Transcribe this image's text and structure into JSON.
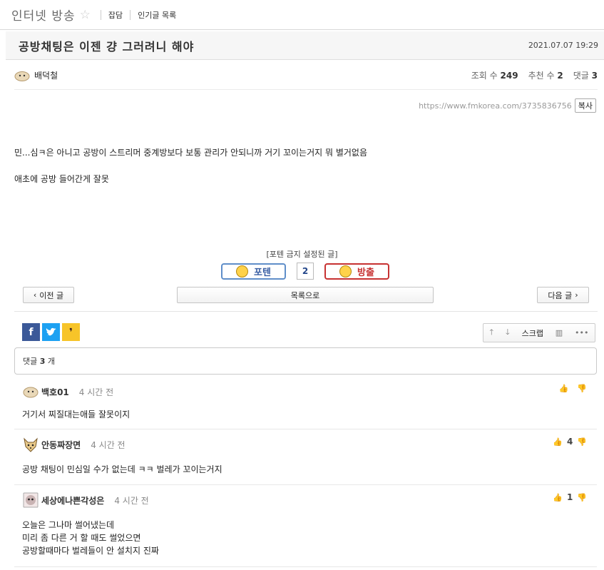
{
  "board": {
    "title": "인터넷 방송",
    "star_icon": "star-outline-icon",
    "links": [
      "잡담",
      "인기글 목록"
    ]
  },
  "post": {
    "title": "공방채팅은 이젠 걍 그러려니 해야",
    "date": "2021.07.07 19:29",
    "author": "배덕철",
    "views_label": "조회 수",
    "views": "249",
    "recommend_label": "추천 수",
    "recommend": "2",
    "comments_label": "댓글",
    "comments": "3",
    "url": "https://www.fmkorea.com/3735836756",
    "copy_label": "복사",
    "body_line1": "민...심ㅋ은 아니고 공방이 스트리머 중계방보다 보통 관리가 안되니까 거기 꼬이는거지 뭐 별거없음",
    "body_line2": "애초에 공방 들어간게 잘못"
  },
  "vote": {
    "notice": "[포텐 금지 설정된 글]",
    "up_label": "포텐",
    "count": "2",
    "down_label": "방출"
  },
  "nav": {
    "prev_label": "이전 글",
    "list_label": "목록으로",
    "next_label": "다음 글"
  },
  "tools": {
    "scrap_label": "스크랩"
  },
  "comment_summary": {
    "label": "댓글",
    "count": "3",
    "unit": "개"
  },
  "comments": [
    {
      "name": "백호01",
      "time": "4 시간 전",
      "votes": "",
      "lines": [
        "거기서 찌질대는애들 잘못이지"
      ]
    },
    {
      "name": "안동짜장면",
      "time": "4 시간 전",
      "votes": "4",
      "lines": [
        "공방 채팅이 민심일 수가 없는데 ㅋㅋ 벌레가 꼬이는거지"
      ]
    },
    {
      "name": "세상에나쁜각성은",
      "time": "4 시간 전",
      "votes": "1",
      "lines": [
        "오늘은 그나마 썰어냈는데",
        "미리 좀 다른 거 할 때도 썰었으면",
        "공방할때마다 벌레들이 안 설치지 진짜"
      ]
    }
  ],
  "colors": {
    "potten_blue": "#5f8ec9",
    "bangchul_red": "#c73232",
    "facebook": "#3b5998",
    "twitter": "#1da1f2",
    "kakao": "#f7c429"
  }
}
